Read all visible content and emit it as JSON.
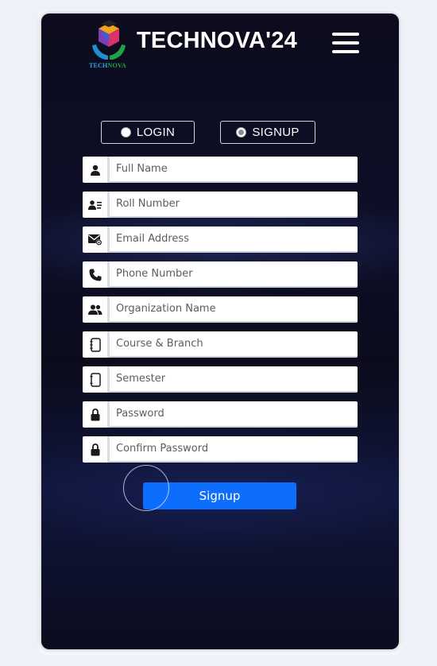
{
  "header": {
    "brand": "TECHNOVA'24",
    "logo_text_part1": "TECH",
    "logo_text_part2": "NOVA",
    "menu_icon": "hamburger-menu-icon"
  },
  "auth_toggle": {
    "login_label": "LOGIN",
    "signup_label": "SIGNUP",
    "selected": "signup"
  },
  "form": {
    "fields": [
      {
        "placeholder": "Full Name",
        "icon": "user-icon",
        "value": ""
      },
      {
        "placeholder": "Roll Number",
        "icon": "id-card-icon",
        "value": ""
      },
      {
        "placeholder": "Email Address",
        "icon": "envelope-at-icon",
        "value": ""
      },
      {
        "placeholder": "Phone Number",
        "icon": "phone-icon",
        "value": ""
      },
      {
        "placeholder": "Organization Name",
        "icon": "users-icon",
        "value": ""
      },
      {
        "placeholder": "Course & Branch",
        "icon": "book-icon",
        "value": ""
      },
      {
        "placeholder": "Semester",
        "icon": "notebook-icon",
        "value": ""
      },
      {
        "placeholder": "Password",
        "icon": "lock-icon",
        "value": ""
      },
      {
        "placeholder": "Confirm Password",
        "icon": "lock-icon",
        "value": ""
      }
    ],
    "submit_label": "Signup"
  },
  "colors": {
    "accent": "#0d6efd",
    "panel_bg": "#0c0c1d",
    "page_bg": "#eef1f8"
  }
}
